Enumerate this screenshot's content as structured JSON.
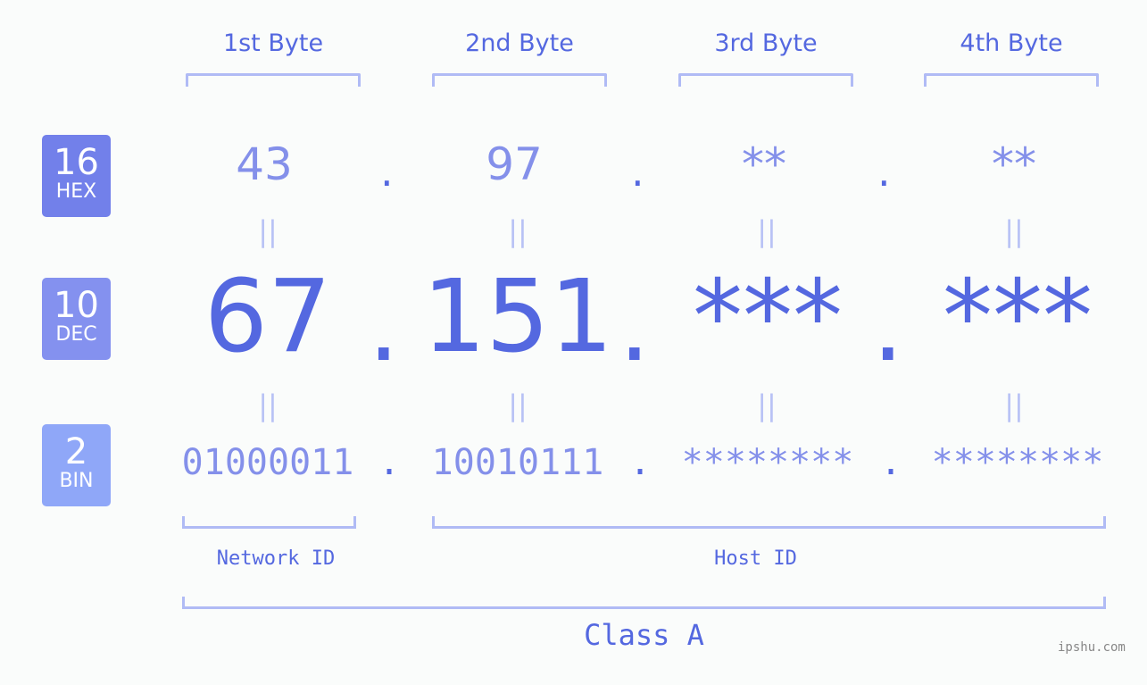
{
  "bytes": [
    {
      "header": "1st Byte",
      "hex": "43",
      "dec": "67",
      "bin": "01000011"
    },
    {
      "header": "2nd Byte",
      "hex": "97",
      "dec": "151",
      "bin": "10010111"
    },
    {
      "header": "3rd Byte",
      "hex": "**",
      "dec": "***",
      "bin": "********"
    },
    {
      "header": "4th Byte",
      "hex": "**",
      "dec": "***",
      "bin": "********"
    }
  ],
  "bases": [
    {
      "num": "16",
      "label": "HEX",
      "color": "#7280ea"
    },
    {
      "num": "10",
      "label": "DEC",
      "color": "#8491ef"
    },
    {
      "num": "2",
      "label": "BIN",
      "color": "#8fa7f8"
    }
  ],
  "separator": ".",
  "equals_glyph": "||",
  "network_label": "Network ID",
  "host_label": "Host ID",
  "class_label": "Class A",
  "watermark": "ipshu.com",
  "colors": {
    "accent": "#5468e0",
    "light": "#8490ea",
    "bracket": "#b0bbf5"
  }
}
